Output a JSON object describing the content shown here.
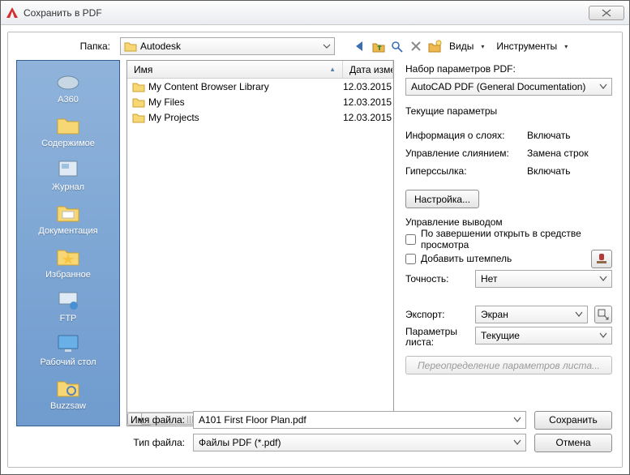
{
  "window": {
    "title": "Сохранить в PDF"
  },
  "top": {
    "folder_label": "Папка:",
    "folder_value": "Autodesk",
    "views_label": "Виды",
    "tools_label": "Инструменты"
  },
  "sidebar": {
    "items": [
      {
        "label": "A360"
      },
      {
        "label": "Содержимое"
      },
      {
        "label": "Журнал"
      },
      {
        "label": "Документация"
      },
      {
        "label": "Избранное"
      },
      {
        "label": "FTP"
      },
      {
        "label": "Рабочий стол"
      },
      {
        "label": "Buzzsaw"
      }
    ]
  },
  "filelist": {
    "col_name": "Имя",
    "col_date": "Дата изме",
    "rows": [
      {
        "name": "My Content Browser Library",
        "date": "12.03.2015"
      },
      {
        "name": "My Files",
        "date": "12.03.2015"
      },
      {
        "name": "My Projects",
        "date": "12.03.2015"
      }
    ]
  },
  "right": {
    "preset_label": "Набор параметров PDF:",
    "preset_value": "AutoCAD PDF (General Documentation)",
    "current_params": "Текущие параметры",
    "p1k": "Информация о слоях:",
    "p1v": "Включать",
    "p2k": "Управление слиянием:",
    "p2v": "Замена строк",
    "p3k": "Гиперссылка:",
    "p3v": "Включать",
    "settings_btn": "Настройка...",
    "output_title": "Управление выводом",
    "chk_open": "По завершении открыть в средстве просмотра",
    "chk_stamp": "Добавить штемпель",
    "precision_label": "Точность:",
    "precision_value": "Нет",
    "export_label": "Экспорт:",
    "export_value": "Экран",
    "sheet_label": "Параметры листа:",
    "sheet_value": "Текущие",
    "override_btn": "Переопределение параметров листа..."
  },
  "bottom": {
    "filename_label": "Имя файла:",
    "filename_value": "A101 First Floor Plan.pdf",
    "filetype_label": "Тип файла:",
    "filetype_value": "Файлы PDF (*.pdf)",
    "save_btn": "Сохранить",
    "cancel_btn": "Отмена"
  }
}
